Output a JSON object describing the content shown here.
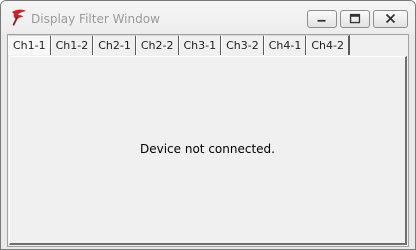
{
  "window": {
    "title": "Display Filter Window"
  },
  "tabs": [
    {
      "label": "Ch1-1",
      "active": true
    },
    {
      "label": "Ch1-2",
      "active": false
    },
    {
      "label": "Ch2-1",
      "active": false
    },
    {
      "label": "Ch2-2",
      "active": false
    },
    {
      "label": "Ch3-1",
      "active": false
    },
    {
      "label": "Ch3-2",
      "active": false
    },
    {
      "label": "Ch4-1",
      "active": false
    },
    {
      "label": "Ch4-2",
      "active": false
    }
  ],
  "panel": {
    "message": "Device not connected."
  },
  "icons": {
    "app": "red-feather-icon",
    "minimize": "minimize-icon",
    "maximize": "maximize-icon",
    "close": "close-icon"
  },
  "colors": {
    "app_icon": "#c0262c",
    "title_text": "#9a9a9a"
  }
}
